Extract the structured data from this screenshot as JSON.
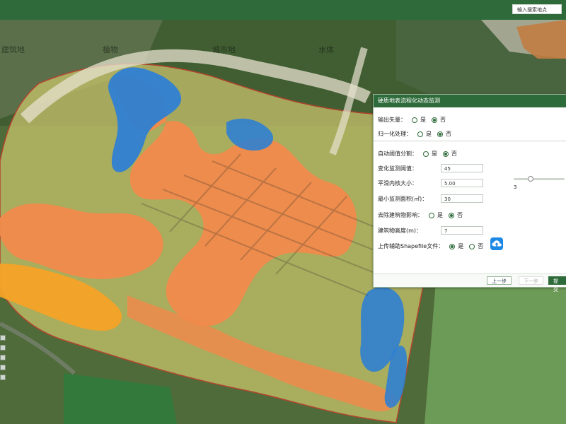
{
  "search": {
    "placeholder": "输入搜索地点"
  },
  "map": {
    "layers": [
      "建筑地",
      "植物",
      "城市地",
      "水体"
    ]
  },
  "panel": {
    "title": "硬质地表流程化动态监测",
    "fields": {
      "output_vector": {
        "label": "输出矢量：",
        "options": [
          "是",
          "否"
        ],
        "selected": "否"
      },
      "normalize": {
        "label": "归一化处理：",
        "options": [
          "是",
          "否"
        ],
        "selected": "否"
      },
      "auto_threshold": {
        "label": "自动阈值分割：",
        "options": [
          "是",
          "否"
        ],
        "selected": "否"
      },
      "change_threshold": {
        "label": "变化监测阈值：",
        "value": "45"
      },
      "smooth_kernel": {
        "label": "平滑内核大小：",
        "value": "5.00"
      },
      "min_area": {
        "label": "最小监测面积(㎡)：",
        "value": "30"
      },
      "remove_building": {
        "label": "去除建筑物影响：",
        "options": [
          "是",
          "否"
        ],
        "selected": "否"
      },
      "building_height": {
        "label": "建筑物高度(m)：",
        "value": "7"
      },
      "upload_shapefile": {
        "label": "上传辅助Shapefile文件：",
        "options": [
          "是",
          "否"
        ],
        "selected": "是"
      }
    },
    "slider": {
      "value_label": "3"
    },
    "buttons": {
      "prev": "上一步",
      "next": "下一步",
      "submit": "提交"
    }
  },
  "colors": {
    "header_green": "#2e6b3a",
    "map_green": "#3e5a2e",
    "orange": "#f08a4b",
    "blue": "#2f7fd2",
    "outline_red": "#d23a2d"
  }
}
